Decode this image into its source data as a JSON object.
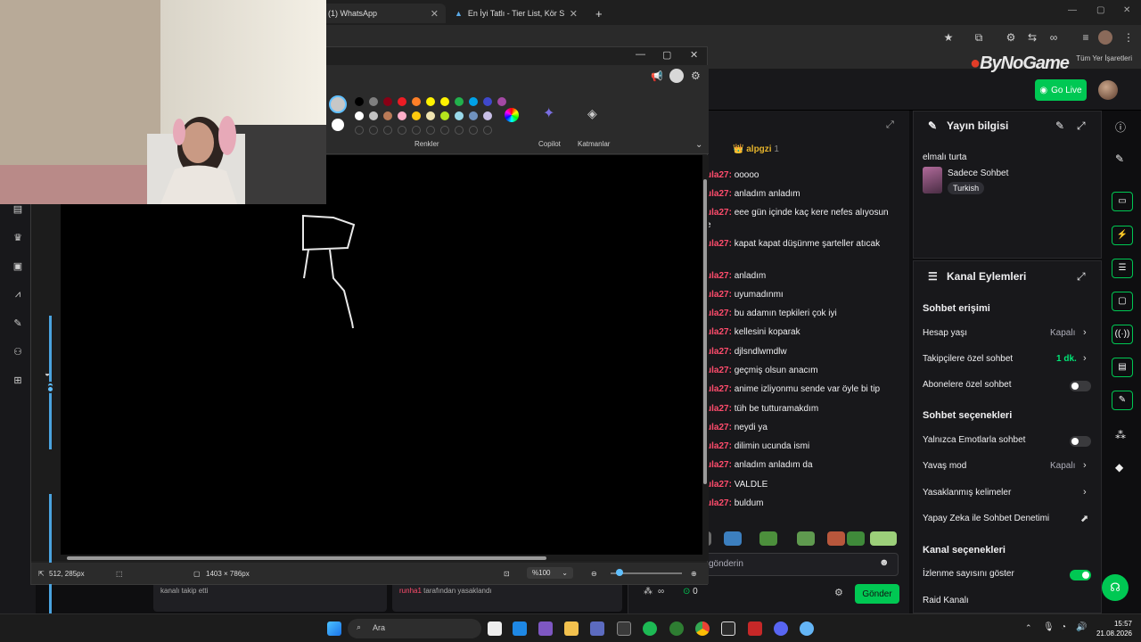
{
  "browser": {
    "tabs": [
      {
        "label": "(1) WhatsApp"
      },
      {
        "label": "En İyi Tatlı - Tier List, Kör Sıralan"
      }
    ],
    "new_tab": "+",
    "bookmarks_label": "Tüm Yer İşaretleri"
  },
  "header": {
    "brand": "ByNoGame",
    "go_live": "Go Live"
  },
  "chat": {
    "top_chatter": {
      "name": "alpgzi",
      "count": "1"
    },
    "messages": [
      {
        "user": "ula27:",
        "text": "ooooo"
      },
      {
        "user": "ula27:",
        "text": "anladım anladım"
      },
      {
        "user": "ula27:",
        "text": "eee gün içinde kaç kere nefes alıyosun e"
      },
      {
        "user": "ula27:",
        "text": "kapat kapat düşünme şarteller atıcak"
      },
      {
        "user": "ula27:",
        "text": "anladım"
      },
      {
        "user": "ula27:",
        "text": "uyumadınmı"
      },
      {
        "user": "ula27:",
        "text": "bu adamın tepkileri çok iyi"
      },
      {
        "user": "ula27:",
        "text": "kellesini koparak"
      },
      {
        "user": "ula27:",
        "text": "djlsndlwmdlw"
      },
      {
        "user": "ula27:",
        "text": "geçmiş olsun anacım"
      },
      {
        "user": "ula27:",
        "text": "anime izliyonmu sende var öyle bi tip"
      },
      {
        "user": "ula27:",
        "text": "tüh be tutturamakdım"
      },
      {
        "user": "ula27:",
        "text": "neydi ya"
      },
      {
        "user": "ula27:",
        "text": "dilimin ucunda ismi"
      },
      {
        "user": "ula27:",
        "text": "anladım anladım da"
      },
      {
        "user": "ula27:",
        "text": "VALDLE"
      },
      {
        "user": "ula27:",
        "text": "buldum"
      }
    ],
    "input_placeholder": "gönderin",
    "points": "0",
    "send": "Gönder"
  },
  "stream_info": {
    "title": "Yayın bilgisi",
    "stream_title": "elmalı turta",
    "category": "Sadece Sohbet",
    "language": "Turkish"
  },
  "channel_actions": {
    "title": "Kanal Eylemleri",
    "sections": [
      {
        "title": "Sohbet erişimi"
      },
      {
        "title": "Sohbet seçenekleri"
      },
      {
        "title": "Kanal seçenekleri"
      }
    ],
    "rows": [
      {
        "label": "Hesap yaşı",
        "value": "Kapalı"
      },
      {
        "label": "Takipçilere özel sohbet",
        "value": "1 dk."
      },
      {
        "label": "Abonelere özel sohbet",
        "value": ""
      },
      {
        "label": "Yalnızca Emotlarla sohbet",
        "value": ""
      },
      {
        "label": "Yavaş mod",
        "value": "Kapalı"
      },
      {
        "label": "Yasaklanmış kelimeler",
        "value": ""
      },
      {
        "label": "Yapay Zeka ile Sohbet Denetimi",
        "value": ""
      },
      {
        "label": "İzlenme sayısını göster",
        "value": ""
      },
      {
        "label": "Raid Kanalı",
        "value": ""
      }
    ],
    "toggles": {
      "subscribers_only": false,
      "emote_only": false,
      "show_viewcount": true
    }
  },
  "below_cards": [
    {
      "text": "kanalı takip etti"
    },
    {
      "user": "runha1",
      "text": "tarafından yasaklandı"
    }
  ],
  "paint": {
    "colors_label": "Renkler",
    "copilot_label": "Copilot",
    "layers_label": "Katmanlar",
    "cursor_pos": "512, 285px",
    "canvas_size": "1403 × 786px",
    "zoom": "%100",
    "zoom_level": 0.08,
    "palette_row1": [
      "#000000",
      "#7f7f7f",
      "#880015",
      "#ed1c24",
      "#ff7f27",
      "#fff200",
      "#fff200",
      "#22b14c",
      "#00a2e8",
      "#3f48cc",
      "#a349a4"
    ],
    "palette_row2": [
      "#ffffff",
      "#c3c3c3",
      "#b97a57",
      "#ffaec9",
      "#ffc90e",
      "#efe4b0",
      "#b5e61d",
      "#99d9ea",
      "#7092be",
      "#c8bfe7"
    ]
  },
  "taskbar": {
    "search": "Ara",
    "time": "15:57",
    "date": "21.08.2026"
  }
}
